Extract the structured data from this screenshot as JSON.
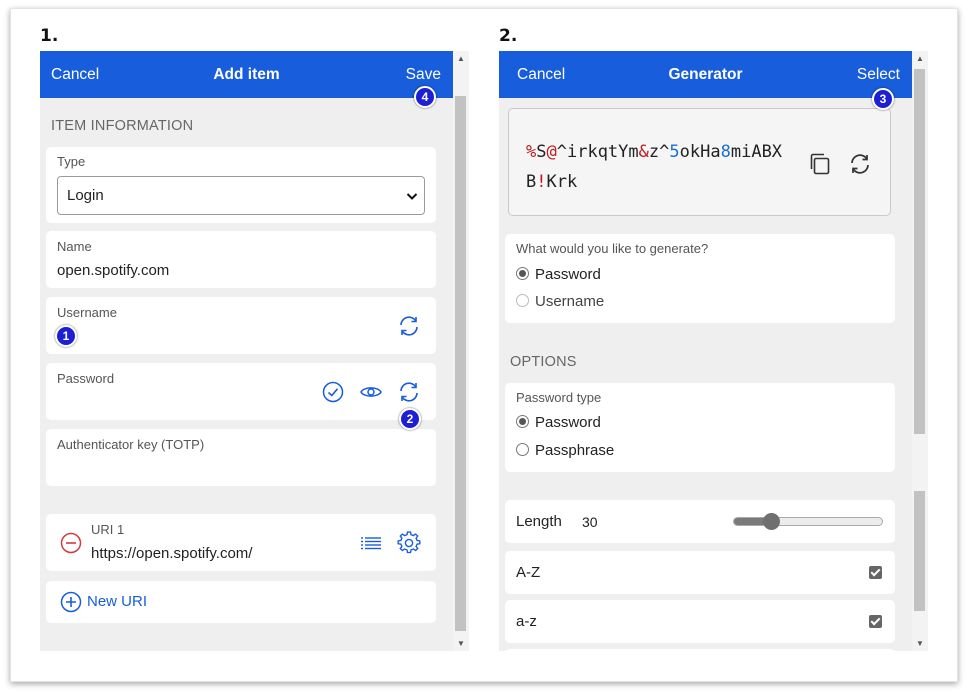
{
  "steps": {
    "step1": "1.",
    "step2": "2."
  },
  "add_item": {
    "header": {
      "cancel": "Cancel",
      "title": "Add item",
      "save": "Save"
    },
    "section_title": "ITEM INFORMATION",
    "type": {
      "label": "Type",
      "value": "Login"
    },
    "name": {
      "label": "Name",
      "value": "open.spotify.com"
    },
    "username": {
      "label": "Username",
      "value": ""
    },
    "password": {
      "label": "Password",
      "value": ""
    },
    "totp": {
      "label": "Authenticator key (TOTP)",
      "value": ""
    },
    "uri": {
      "label": "URI 1",
      "value": "https://open.spotify.com/"
    },
    "new_uri": "New URI"
  },
  "generator": {
    "header": {
      "cancel": "Cancel",
      "title": "Generator",
      "select": "Select"
    },
    "password_segments": [
      {
        "t": "%",
        "c": "sp"
      },
      {
        "t": "S",
        "c": ""
      },
      {
        "t": "@",
        "c": "sp"
      },
      {
        "t": "^irkqtYm",
        "c": ""
      },
      {
        "t": "&",
        "c": "sp"
      },
      {
        "t": "z",
        "c": ""
      },
      {
        "t": "^",
        "c": ""
      },
      {
        "t": "5",
        "c": "num"
      },
      {
        "t": "okHa",
        "c": ""
      },
      {
        "t": "8",
        "c": "num"
      },
      {
        "t": "mi",
        "c": ""
      },
      {
        "t": "ABXB",
        "c": ""
      },
      {
        "t": "!",
        "c": "sp"
      },
      {
        "t": "Krk",
        "c": ""
      }
    ],
    "what_label": "What would you like to generate?",
    "what_options": [
      {
        "label": "Password",
        "selected": true
      },
      {
        "label": "Username",
        "selected": false
      }
    ],
    "options_title": "OPTIONS",
    "pw_type_label": "Password type",
    "pw_type_options": [
      {
        "label": "Password",
        "selected": true
      },
      {
        "label": "Passphrase",
        "selected": false
      }
    ],
    "length": {
      "label": "Length",
      "value": "30",
      "fraction": 0.25
    },
    "az_upper": {
      "label": "A-Z",
      "checked": true
    },
    "az_lower": {
      "label": "a-z",
      "checked": true
    }
  },
  "badges": {
    "b1": "1",
    "b2": "2",
    "b3": "3",
    "b4": "4"
  },
  "colors": {
    "header": "#175ddc",
    "badge": "#1d1fd4",
    "special": "#c01a1a",
    "number": "#1a6fd3",
    "icon": "#175ddc",
    "remove": "#d43b3b"
  }
}
